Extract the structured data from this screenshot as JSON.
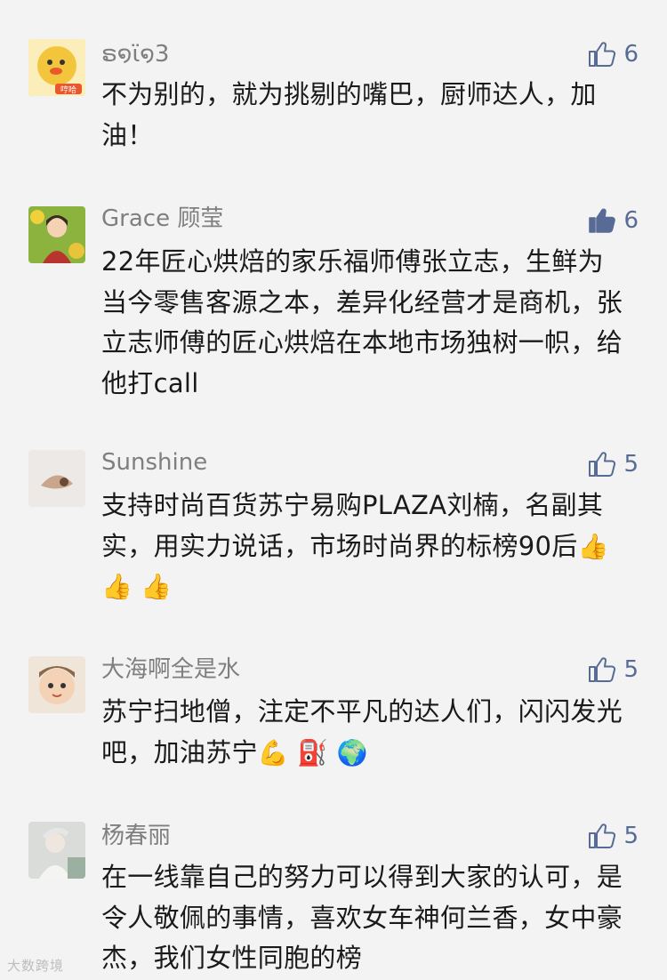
{
  "comments": [
    {
      "name": "ຣ໑ϊ໑3",
      "likes": "6",
      "liked": false,
      "avatar_text": "哼哈",
      "avatar_color": "#f1c94a",
      "text": "不为别的，就为挑剔的嘴巴，厨师达人，加油！",
      "emojis": ""
    },
    {
      "name": "Grace 顾莹",
      "likes": "6",
      "liked": true,
      "avatar_text": "",
      "avatar_color": "#7ea83a",
      "text": "22年匠心烘焙的家乐福师傅张立志，生鲜为当今零售客源之本，差异化经营才是商机，张立志师傅的匠心烘焙在本地市场独树一帜，给他打call",
      "emojis": ""
    },
    {
      "name": "Sunshine",
      "likes": "5",
      "liked": false,
      "avatar_text": "",
      "avatar_color": "#e9e6e3",
      "text": "支持时尚百货苏宁易购PLAZA刘楠，名副其实，用实力说话，市场时尚界的标榜90后",
      "emojis": "👍 👍 👍"
    },
    {
      "name": "大海啊全是水",
      "likes": "5",
      "liked": false,
      "avatar_text": "",
      "avatar_color": "#d9b79a",
      "text": "苏宁扫地僧，注定不平凡的达人们，闪闪发光吧，加油苏宁",
      "emojis": "💪 ⛽ 🌍"
    },
    {
      "name": "杨春丽",
      "likes": "5",
      "liked": false,
      "avatar_text": "",
      "avatar_color": "#cfd4d0",
      "text": "在一线靠自己的努力可以得到大家的认可，是令人敬佩的事情，喜欢女车神何兰香，女中豪杰，我们女性同胞的榜",
      "emojis": ""
    }
  ],
  "watermark": "大数跨境",
  "colors": {
    "accent": "#576b95",
    "name": "#7f7f7f",
    "text": "#1a1a1a",
    "bg": "#f3f3f3"
  }
}
